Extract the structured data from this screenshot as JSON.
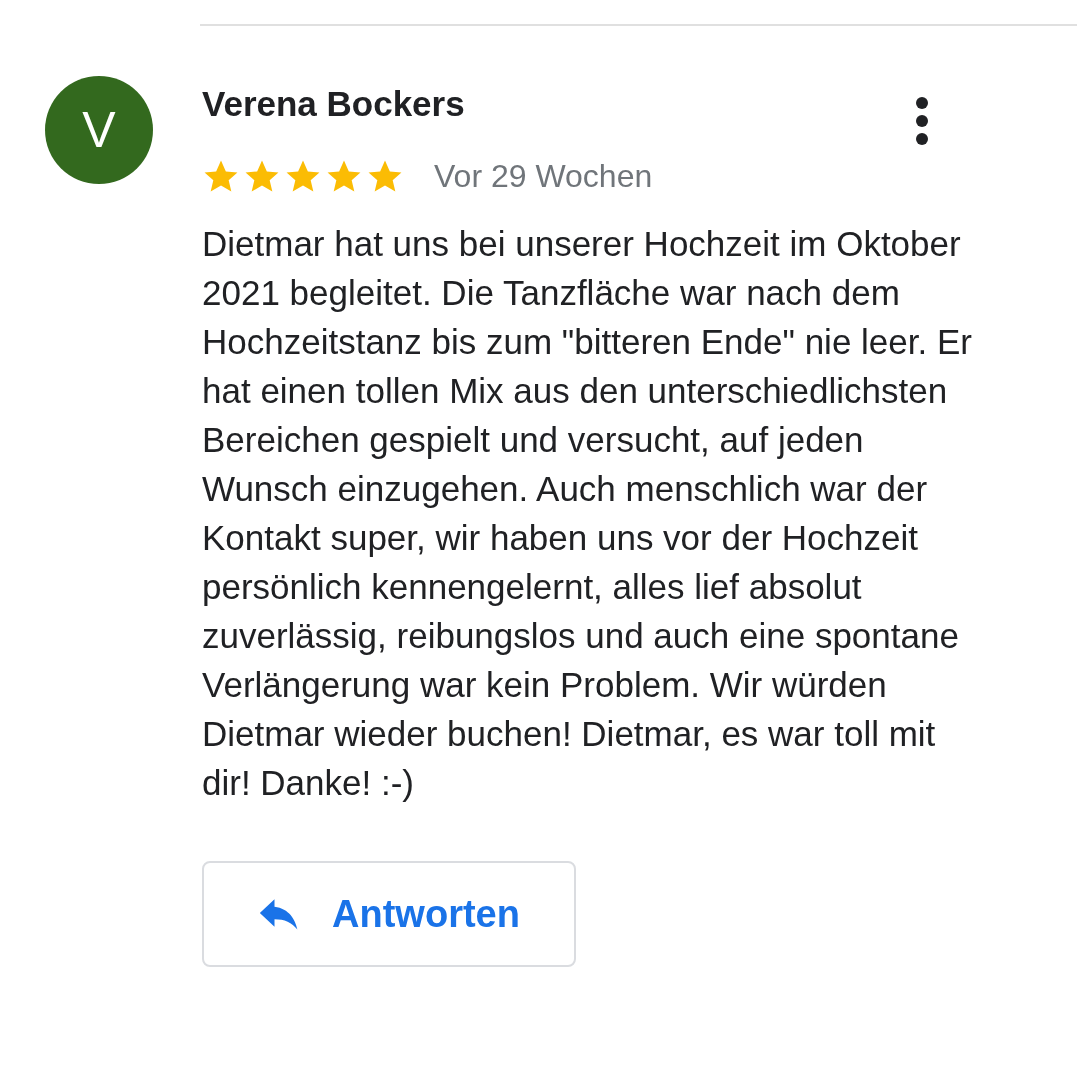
{
  "review": {
    "avatar_letter": "V",
    "author": "Verena Bockers",
    "stars": 5,
    "time": "Vor 29 Wochen",
    "text": "Dietmar hat uns bei unserer Hochzeit im Oktober 2021 begleitet. Die Tanzfläche war nach dem Hochzeitstanz bis zum \"bitteren Ende\" nie leer. Er hat einen tollen Mix aus den unterschiedlichsten Bereichen gespielt und versucht, auf jeden Wunsch einzugehen. Auch menschlich war der Kontakt super, wir haben uns vor der Hochzeit persönlich kennengelernt, alles lief absolut zuverlässig, reibungslos und auch eine spontane Verlängerung war kein Problem. Wir würden Dietmar wieder buchen! Dietmar, es war toll mit dir! Danke! :-)",
    "reply_button": "Antworten"
  }
}
